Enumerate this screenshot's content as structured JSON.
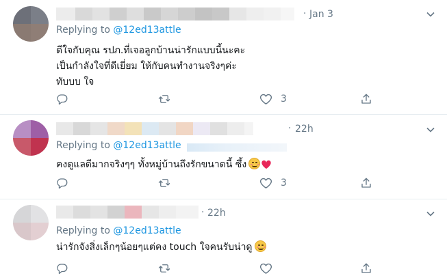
{
  "colors": {
    "link": "#1b95e0",
    "meta": "#657786",
    "text": "#14171a",
    "divider": "#e6ecf0"
  },
  "icons": {
    "reply": "reply-icon",
    "retweet": "retweet-icon",
    "like": "heart-icon",
    "share": "share-icon",
    "more": "chevron-down-icon"
  },
  "tweets": [
    {
      "separator": "·",
      "time": "Jan 3",
      "replying_label": "Replying to",
      "reply_handle": "@12ed13attle",
      "lines": [
        "ดีใจกับคุณ รปภ.ที่เจอลูกบ้านน่ารักแบบนี้นะคะ",
        "เป็นกำลังใจที่ดีเยี่ยม ให้กับคนทำงานจริงๆค่ะ",
        "ทับบบ ใจ"
      ],
      "reply_count": "",
      "retweet_count": "",
      "like_count": "3"
    },
    {
      "separator": "·",
      "time": "22h",
      "replying_label": "Replying to",
      "reply_handle": "@12ed13attle",
      "lines": [
        "คงดูแลดีมากจริงๆๆ ทั้งหมู่บ้านถึงรักขนาดนี้ ซึ้ง"
      ],
      "reply_count": "",
      "retweet_count": "",
      "like_count": "3"
    },
    {
      "separator": "·",
      "time": "22h",
      "replying_label": "Replying to",
      "reply_handle": "@12ed13attle",
      "lines": [
        "น่ารักจังสิ่งเล็กๆน้อยๆแต่คง touch ใจคนรับน่าดู"
      ],
      "reply_count": "",
      "retweet_count": "",
      "like_count": ""
    }
  ]
}
